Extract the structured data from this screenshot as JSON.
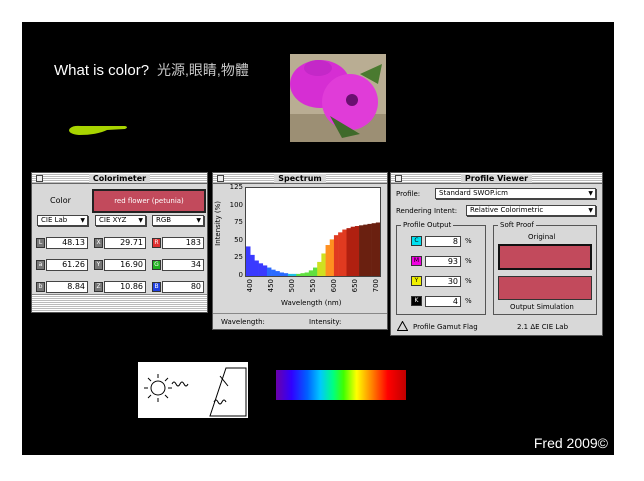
{
  "slide": {
    "title": "What is color?",
    "title_cn": "光源,眼睛,物體",
    "credit": "Fred 2009©"
  },
  "colorimeter": {
    "window_title": "Colorimeter",
    "color_label": "Color",
    "swatch_label": "red flower (petunia)",
    "swatch_color": "#c24a5c",
    "menus": [
      "CIE Lab",
      "CIE XYZ",
      "RGB"
    ],
    "rows": [
      [
        {
          "chip": "L",
          "value": "48.13"
        },
        {
          "chip": "X",
          "value": "29.71"
        },
        {
          "chip": "R",
          "value": "183",
          "color": "#e03030"
        }
      ],
      [
        {
          "chip": "a",
          "value": "61.26"
        },
        {
          "chip": "Y",
          "value": "16.90"
        },
        {
          "chip": "G",
          "value": "34",
          "color": "#20b020"
        }
      ],
      [
        {
          "chip": "b",
          "value": "8.84"
        },
        {
          "chip": "Z",
          "value": "10.86"
        },
        {
          "chip": "B",
          "value": "80",
          "color": "#2040e0"
        }
      ]
    ]
  },
  "spectrum": {
    "window_title": "Spectrum",
    "ylabel": "Intensity (%)",
    "xlabel": "Wavelength (nm)",
    "footer_wavelength": "Wavelength:",
    "footer_intensity": "Intensity:"
  },
  "chart_data": {
    "type": "bar",
    "title": "Spectrum",
    "xlabel": "Wavelength (nm)",
    "ylabel": "Intensity (%)",
    "ylim": [
      0,
      125
    ],
    "xlim": [
      390,
      710
    ],
    "yticks": [
      0,
      25,
      50,
      75,
      100,
      125
    ],
    "xticks": [
      400,
      450,
      500,
      550,
      600,
      650,
      700
    ],
    "x": [
      390,
      400,
      410,
      420,
      430,
      440,
      450,
      460,
      470,
      480,
      490,
      500,
      510,
      520,
      530,
      540,
      550,
      560,
      570,
      580,
      590,
      600,
      610,
      620,
      630,
      640,
      650,
      660,
      670,
      680,
      690,
      700
    ],
    "values": [
      42,
      30,
      22,
      18,
      15,
      12,
      9,
      7,
      5,
      4,
      3,
      3,
      3,
      4,
      5,
      8,
      12,
      20,
      32,
      44,
      52,
      58,
      62,
      66,
      68,
      70,
      71,
      72,
      73,
      74,
      75,
      76
    ]
  },
  "profile_viewer": {
    "window_title": "Profile Viewer",
    "profile_label": "Profile:",
    "profile_value": "Standard SWOP.icm",
    "intent_label": "Rendering Intent:",
    "intent_value": "Relative Colorimetric",
    "output_group": "Profile Output",
    "inks": [
      {
        "chip": "C",
        "value": "8",
        "color": "#00e0f0"
      },
      {
        "chip": "M",
        "value": "93",
        "color": "#f000e0"
      },
      {
        "chip": "Y",
        "value": "30",
        "color": "#f0f000"
      },
      {
        "chip": "K",
        "value": "4",
        "color": "#000000"
      }
    ],
    "pct": "%",
    "proof_group": "Soft Proof",
    "original_label": "Original",
    "simulation_label": "Output Simulation",
    "gamut_label": "Profile Gamut Flag",
    "delta_label": "2.1 ΔE CIE Lab"
  }
}
